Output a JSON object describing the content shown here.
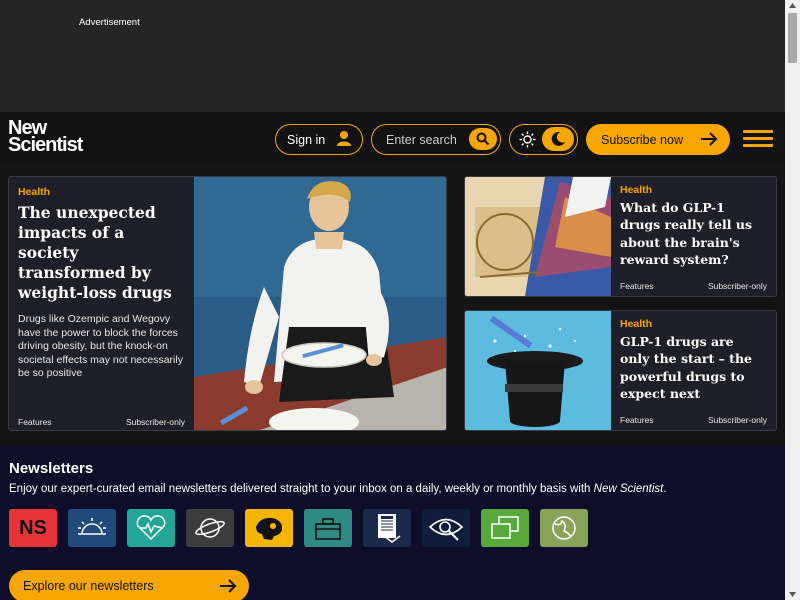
{
  "ad": {
    "label": "Advertisement"
  },
  "header": {
    "logo_line1": "New",
    "logo_line2": "Scientist",
    "signin_label": "Sign in",
    "search_placeholder": "Enter search",
    "subscribe_label": "Subscribe now",
    "accent_color": "#f7a600"
  },
  "main_article": {
    "tag": "Health",
    "title": "The unexpected impacts of a society transformed by weight-loss drugs",
    "description": "Drugs like Ozempic and Wegovy have the power to block the forces driving obesity, but the knock-on societal effects may not necessarily be so positive",
    "type": "Features",
    "access": "Subscriber-only"
  },
  "side_articles": [
    {
      "tag": "Health",
      "title": "What do GLP-1 drugs really tell us about the brain's reward system?",
      "type": "Features",
      "access": "Subscriber-only"
    },
    {
      "tag": "Health",
      "title": "GLP-1 drugs are only the start – the powerful drugs to expect next",
      "type": "Features",
      "access": "Subscriber-only"
    }
  ],
  "newsletters": {
    "title": "Newsletters",
    "description_prefix": "Enjoy our expert-curated email newsletters delivered straight to your inbox on a daily, weekly or monthly basis with ",
    "description_brand": "New Scientist",
    "description_suffix": ".",
    "icon_ns_text": "NS",
    "explore_label": "Explore our newsletters",
    "icons": [
      {
        "name": "ns-logo-icon",
        "color": "#e8333a"
      },
      {
        "name": "sunrise-icon",
        "color": "#1f4a7a"
      },
      {
        "name": "heartbeat-icon",
        "color": "#23a597"
      },
      {
        "name": "planet-icon",
        "color": "#3c3c3c"
      },
      {
        "name": "fossil-skull-icon",
        "color": "#f7b500"
      },
      {
        "name": "toolbox-icon",
        "color": "#2f8a83"
      },
      {
        "name": "newsletter-document-icon",
        "color": "#1a2a4a"
      },
      {
        "name": "eye-magnifier-icon",
        "color": "#0f1c3a"
      },
      {
        "name": "chat-bubbles-icon",
        "color": "#58a83a"
      },
      {
        "name": "globe-leaf-icon",
        "color": "#8aa35a"
      }
    ]
  }
}
